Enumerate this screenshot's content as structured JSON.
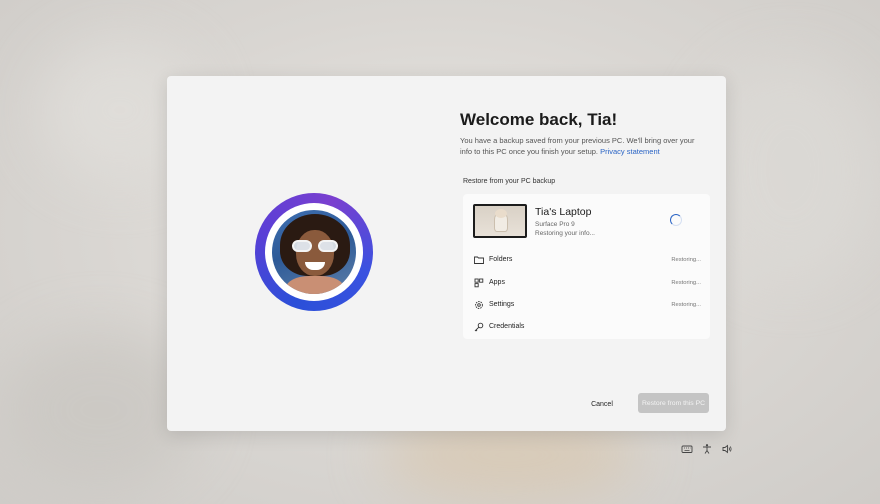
{
  "dialog": {
    "title": "Welcome back, Tia!",
    "description": "You have a backup saved from your previous PC. We'll bring over your info to this PC once you finish your setup.",
    "privacy_link": "Privacy statement",
    "section_label": "Restore from your PC backup",
    "avatar_icon": "user-avatar"
  },
  "backup": {
    "device_name": "Tia's Laptop",
    "device_model": "Surface Pro 9",
    "device_status": "Restoring your info...",
    "items": [
      {
        "label": "Folders",
        "status": "Restoring...",
        "icon": "folder-icon"
      },
      {
        "label": "Apps",
        "status": "Restoring...",
        "icon": "apps-icon"
      },
      {
        "label": "Settings",
        "status": "Restoring...",
        "icon": "gear-icon"
      },
      {
        "label": "Credentials",
        "status": "",
        "icon": "key-icon"
      }
    ]
  },
  "actions": {
    "cancel_label": "Cancel",
    "restore_label": "Restore from this PC"
  },
  "tray": {
    "icons": [
      "keyboard-icon",
      "accessibility-icon",
      "volume-icon"
    ]
  },
  "colors": {
    "accent": "#2a64c5",
    "ring_start": "#2b4fd8",
    "ring_end": "#7a3fcf",
    "disabled_button": "#c4c4c4"
  }
}
